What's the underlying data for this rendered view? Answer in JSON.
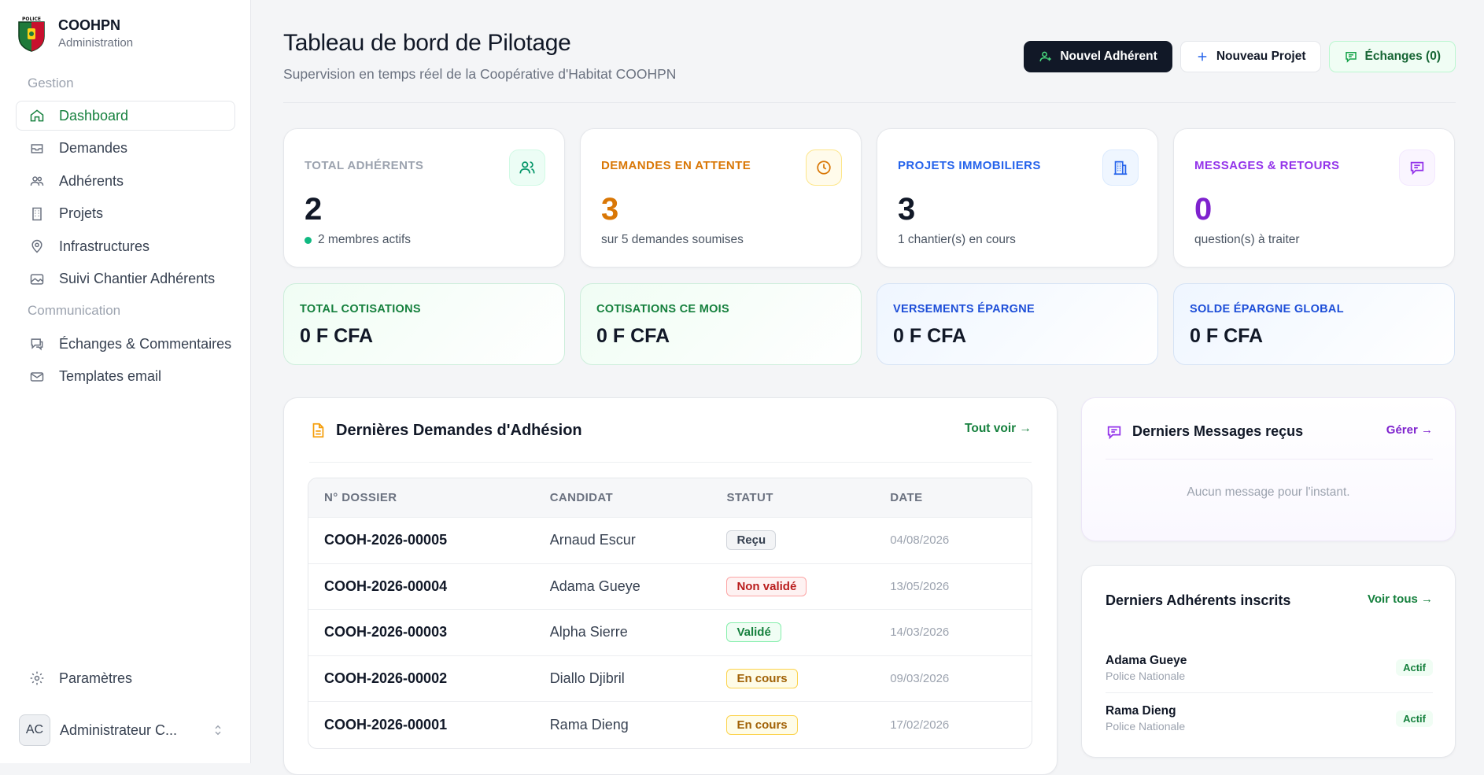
{
  "brand": {
    "name": "COOHPN",
    "subtitle": "Administration",
    "logo_text": "POLICE"
  },
  "sidebar": {
    "group1": "Gestion",
    "items1": [
      {
        "label": "Dashboard",
        "icon": "home-icon",
        "active": true
      },
      {
        "label": "Demandes",
        "icon": "inbox-icon"
      },
      {
        "label": "Adhérents",
        "icon": "users-icon"
      },
      {
        "label": "Projets",
        "icon": "building-icon"
      },
      {
        "label": "Infrastructures",
        "icon": "map-pin-icon"
      },
      {
        "label": "Suivi Chantier Adhérents",
        "icon": "image-icon"
      }
    ],
    "group2": "Communication",
    "items2": [
      {
        "label": "Échanges & Commentaires",
        "icon": "chat-icon"
      },
      {
        "label": "Templates email",
        "icon": "mail-icon"
      }
    ],
    "settings": "Paramètres",
    "user": {
      "initials": "AC",
      "name": "Administrateur C..."
    }
  },
  "header": {
    "title": "Tableau de bord de Pilotage",
    "subtitle": "Supervision en temps réel de la Coopérative d'Habitat COOHPN",
    "btn_new_member": "Nouvel Adhérent",
    "btn_new_project": "Nouveau Projet",
    "btn_exchanges": "Échanges (0)"
  },
  "stats": [
    {
      "label": "TOTAL ADHÉRENTS",
      "value": "2",
      "note": "2 membres actifs",
      "color": "#9ca3af",
      "value_color": "#111827"
    },
    {
      "label": "DEMANDES EN ATTENTE",
      "value": "3",
      "note": "sur 5 demandes soumises",
      "color": "#d97706",
      "value_color": "#d97706"
    },
    {
      "label": "PROJETS IMMOBILIERS",
      "value": "3",
      "note": "1 chantier(s) en cours",
      "color": "#2563eb",
      "value_color": "#111827"
    },
    {
      "label": "MESSAGES & RETOURS",
      "value": "0",
      "note": "question(s) à traiter",
      "color": "#9333ea",
      "value_color": "#7e22ce"
    }
  ],
  "money": [
    {
      "label": "TOTAL COTISATIONS",
      "value": "0 F CFA",
      "color": "#15803d"
    },
    {
      "label": "COTISATIONS CE MOIS",
      "value": "0 F CFA",
      "color": "#15803d"
    },
    {
      "label": "VERSEMENTS ÉPARGNE",
      "value": "0 F CFA",
      "color": "#1d4ed8"
    },
    {
      "label": "SOLDE ÉPARGNE GLOBAL",
      "value": "0 F CFA",
      "color": "#1d4ed8"
    }
  ],
  "demandes": {
    "title": "Dernières Demandes d'Adhésion",
    "link": "Tout voir →",
    "columns": [
      "N° DOSSIER",
      "CANDIDAT",
      "STATUT",
      "DATE"
    ],
    "rows": [
      {
        "dossier": "COOH-2026-00005",
        "candidat": "Arnaud Escur",
        "statut": "Reçu",
        "kind": "recu",
        "date": "04/08/2026"
      },
      {
        "dossier": "COOH-2026-00004",
        "candidat": "Adama Gueye",
        "statut": "Non validé",
        "kind": "non",
        "date": "13/05/2026"
      },
      {
        "dossier": "COOH-2026-00003",
        "candidat": "Alpha Sierre",
        "statut": "Validé",
        "kind": "val",
        "date": "14/03/2026"
      },
      {
        "dossier": "COOH-2026-00002",
        "candidat": "Diallo Djibril",
        "statut": "En cours",
        "kind": "enc",
        "date": "09/03/2026"
      },
      {
        "dossier": "COOH-2026-00001",
        "candidat": "Rama Dieng",
        "statut": "En cours",
        "kind": "enc",
        "date": "17/02/2026"
      }
    ]
  },
  "messages": {
    "title": "Derniers Messages reçus",
    "link": "Gérer →",
    "empty": "Aucun message pour l'instant."
  },
  "adherents": {
    "title": "Derniers Adhérents inscrits",
    "link": "Voir tous →",
    "rows": [
      {
        "name": "Adama Gueye",
        "org": "Police Nationale",
        "status": "Actif"
      },
      {
        "name": "Rama Dieng",
        "org": "Police Nationale",
        "status": "Actif"
      }
    ]
  }
}
